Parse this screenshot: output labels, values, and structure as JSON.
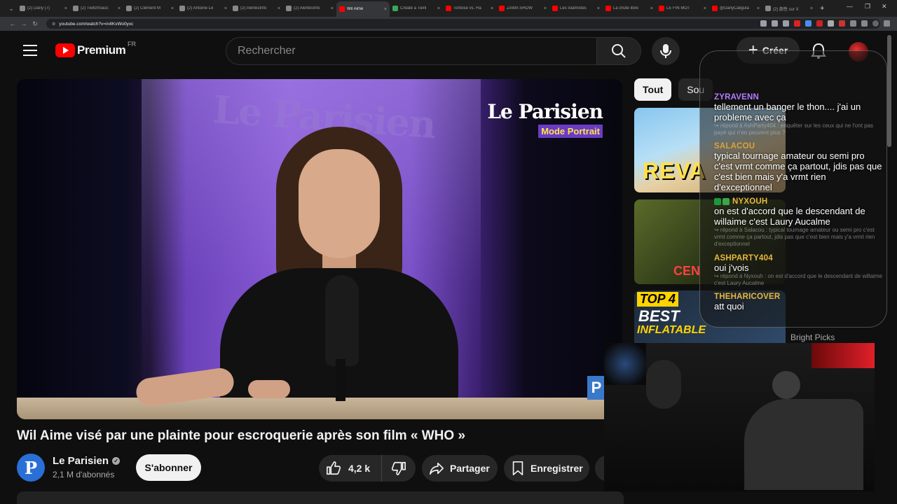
{
  "browser": {
    "tabs": [
      {
        "label": "(2) Dany (7)",
        "color": "#888888",
        "active": false
      },
      {
        "label": "(2) TwitchSauc",
        "color": "#888888",
        "active": false
      },
      {
        "label": "(2) Clément M",
        "color": "#888888",
        "active": false
      },
      {
        "label": "(2) Antoine Lé",
        "color": "#888888",
        "active": false
      },
      {
        "label": "(2) AlertesInfo",
        "color": "#888888",
        "active": false
      },
      {
        "label": "(2) AlertesInfo",
        "color": "#888888",
        "active": false
      },
      {
        "label": "Wil Aime",
        "color": "#ff0000",
        "active": true
      },
      {
        "label": "Create a Tierli",
        "color": "#3aa757",
        "active": false
      },
      {
        "label": "Tortoise vs. Ha",
        "color": "#ff0000",
        "active": false
      },
      {
        "label": "ZAWA SHOW",
        "color": "#ff0000",
        "active": false
      },
      {
        "label": "Les islamistes",
        "color": "#ff0000",
        "active": false
      },
      {
        "label": "La chute libre",
        "color": "#ff0000",
        "active": false
      },
      {
        "label": "LE FIN MOT",
        "color": "#ff0000",
        "active": false
      },
      {
        "label": "@DanyCaligula",
        "color": "#ff0000",
        "active": false
      },
      {
        "label": "(2) 劇性 sur X",
        "color": "#888888",
        "active": false
      }
    ],
    "new_tab": "+",
    "url": "youtube.com/watch?v=in4KvWo0yxc"
  },
  "header": {
    "logo_text": "Premium",
    "country_code": "FR",
    "search_placeholder": "Rechercher",
    "create_label": "Créer"
  },
  "video": {
    "watermark_brand": "Le Parisien",
    "watermark_tag": "Mode Portrait",
    "wall_text": "Le Parisien",
    "corner_badge": "P",
    "title": "Wil Aime visé par une plainte pour escroquerie après son film « WHO »"
  },
  "channel": {
    "avatar_letter": "P",
    "name": "Le Parisien",
    "subscribers": "2,1 M d'abonnés",
    "subscribe_label": "S'abonner"
  },
  "actions": {
    "likes": "4,2 k",
    "share_label": "Partager",
    "save_label": "Enregistrer"
  },
  "sidebar": {
    "chips": [
      {
        "label": "Tout",
        "active": true
      },
      {
        "label": "Sou",
        "active": false
      }
    ],
    "recs": [
      {
        "overlay": "REVA"
      },
      {
        "overlay": "CEN"
      },
      {
        "overlay1": "TOP 4",
        "overlay2": "BEST",
        "overlay3": "INFLATABLE",
        "channel": "Bright Picks"
      }
    ]
  },
  "chat": {
    "messages": [
      {
        "user": "ZYRAVENN",
        "text": "tellement un banger le thon.... j'ai un probleme avec ça",
        "reply": "↪ répond à AshParty404 : enquêter sur les ceux qui ne l'ont pas payé qui n'en peuvent plus ?",
        "user_color": "#b27cff"
      },
      {
        "user": "SALACOU",
        "text": "typical tournage amateur ou semi pro c'est vrmt comme ça partout, jdis pas que c'est bien mais y'a vrmt rien d'exceptionnel",
        "reply": "",
        "user_color": "#d9a23a"
      },
      {
        "user": "NYXOUH",
        "text": "on est d'accord que le descendant de willaime c'est Laury Aucalme",
        "reply": "↪ répond à Salacou : typical tournage amateur ou semi pro c'est vrmt comme ça partout, jdis pas que c'est bien mais y'a vrmt rien d'exceptionnel",
        "user_color": "#e8b83a"
      },
      {
        "user": "ASHPARTY404",
        "text": "oui j'vois",
        "reply": "↪ répond à Nyxouh : on est d'accord que le descendant de willaime c'est Laury Aucalme",
        "user_color": "#e8b83a"
      },
      {
        "user": "THEHARICOVER",
        "text": "att quoi",
        "reply": "",
        "user_color": "#e8b83a"
      }
    ]
  },
  "colors": {
    "accent": "#ff0000",
    "background": "#0f0f0f"
  }
}
